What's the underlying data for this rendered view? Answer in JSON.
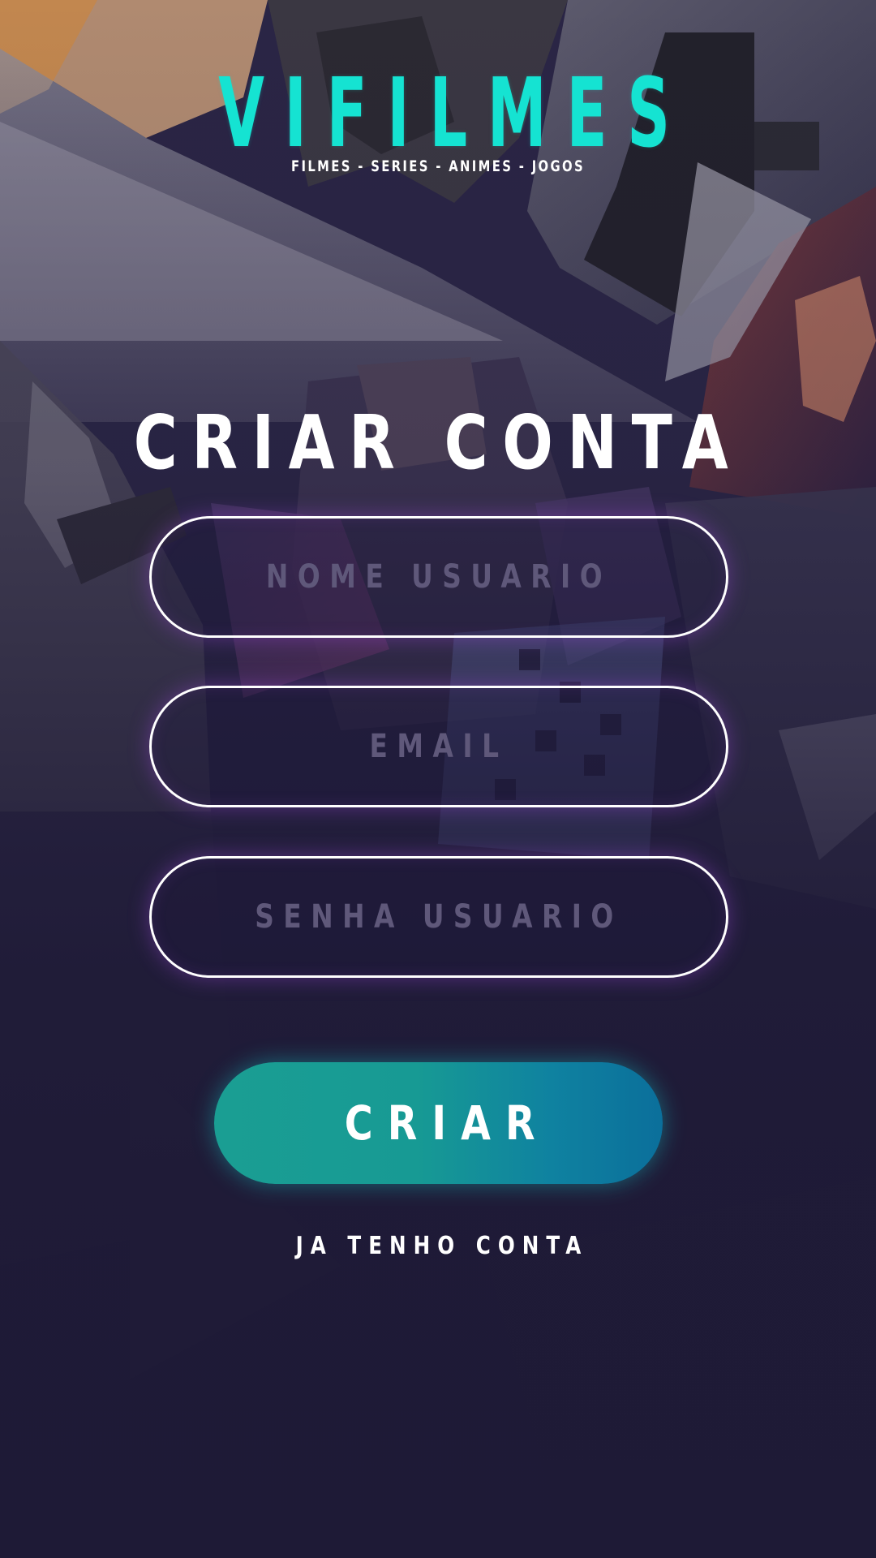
{
  "app": {
    "logo_text": "VIFILMES",
    "tagline": "FILMES - SERIES - ANIMES - JOGOS"
  },
  "form": {
    "title": "CRIAR CONTA",
    "username": {
      "placeholder": "NOME USUARIO",
      "value": ""
    },
    "email": {
      "placeholder": "EMAIL",
      "value": ""
    },
    "password": {
      "placeholder": "SENHA USUARIO",
      "value": ""
    },
    "submit_label": "CRIAR",
    "login_link": "JA TENHO CONTA"
  },
  "colors": {
    "brand_accent": "#15e3d2",
    "background": "#1e1a36",
    "button_gradient_start": "#1a9e93",
    "button_gradient_end": "#0b6f9b",
    "placeholder_text": "#5f587a",
    "field_glow": "#9646d2"
  }
}
